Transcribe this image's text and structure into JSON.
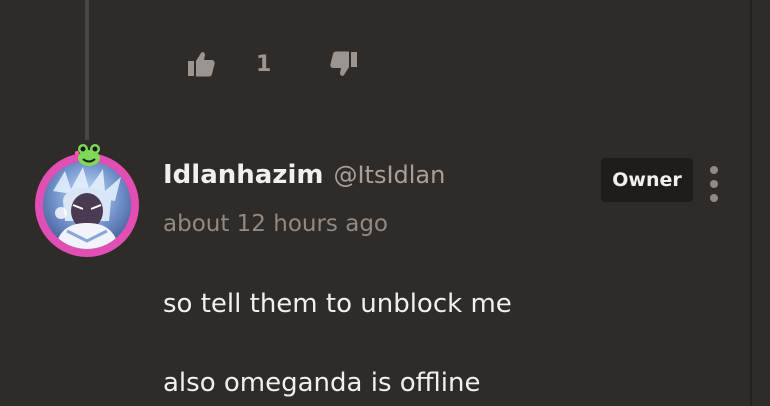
{
  "previous_comment": {
    "votes": {
      "upvote_icon": "thumbs-up-icon",
      "count": "1",
      "downvote_icon": "thumbs-down-icon"
    }
  },
  "comment": {
    "author": {
      "display_name": "Idlanhazim",
      "handle": "@ItsIdlan",
      "avatar_icon": "anime-avatar",
      "badge_icon": "frog-badge-icon"
    },
    "timestamp": "about 12 hours ago",
    "role_badge": "Owner",
    "menu_icon": "more-vertical-icon",
    "body_lines": [
      "so tell them to unblock me",
      "also omeganda is offline"
    ]
  },
  "colors": {
    "background": "#2e2b29",
    "text_primary": "#f2f0ee",
    "text_muted": "#8f8a86",
    "avatar_ring": "#e24fb4",
    "badge_bg": "#1f1d1c"
  }
}
